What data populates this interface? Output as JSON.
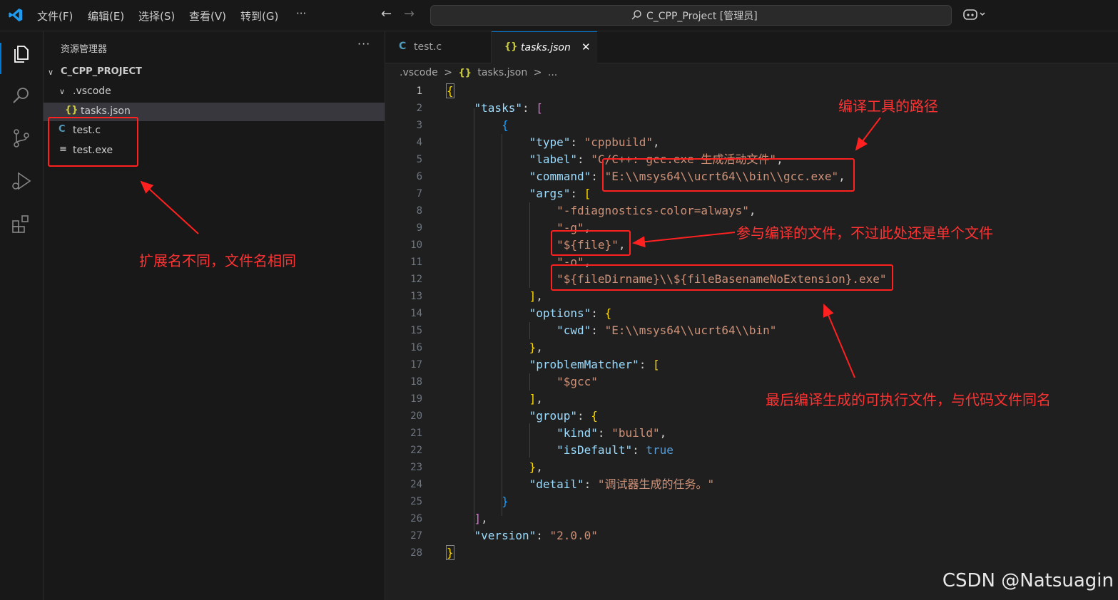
{
  "menu": [
    "文件(F)",
    "编辑(E)",
    "选择(S)",
    "查看(V)",
    "转到(G)",
    "···"
  ],
  "command_center": "C_CPP_Project [管理员]",
  "sidebar": {
    "title": "资源管理器",
    "more": "···",
    "project": "C_CPP_PROJECT",
    "items": [
      {
        "label": ".vscode",
        "icon": "chevron-down-icon"
      },
      {
        "label": "tasks.json",
        "icon": "{}"
      },
      {
        "label": "test.c",
        "icon": "C"
      },
      {
        "label": "test.exe",
        "icon": "≡"
      }
    ]
  },
  "tabs": [
    {
      "icon": "C",
      "label": "test.c"
    },
    {
      "icon": "{}",
      "label": "tasks.json",
      "close": "✕"
    }
  ],
  "breadcrumb": [
    ".vscode",
    ">",
    "{}",
    "tasks.json",
    ">",
    "..."
  ],
  "line_numbers": [
    "1",
    "2",
    "3",
    "4",
    "5",
    "6",
    "7",
    "8",
    "9",
    "10",
    "11",
    "12",
    "13",
    "14",
    "15",
    "16",
    "17",
    "18",
    "19",
    "20",
    "21",
    "22",
    "23",
    "24",
    "25",
    "26",
    "27",
    "28"
  ],
  "code": {
    "l1": "{",
    "l2_key": "\"tasks\"",
    "l2_p": ": ",
    "l2_b": "[",
    "l3": "{",
    "l4_key": "\"type\"",
    "l4_val": "\"cppbuild\"",
    "l5_key": "\"label\"",
    "l5_val": "\"C/C++: gcc.exe 生成活动文件\"",
    "l6_key": "\"command\"",
    "l6_val": "\"E:\\\\msys64\\\\ucrt64\\\\bin\\\\gcc.exe\"",
    "l7_key": "\"args\"",
    "l7_b": "[",
    "l8_val": "\"-fdiagnostics-color=always\"",
    "l9_val": "\"-g\"",
    "l10_val": "\"${file}\"",
    "l11_val": "\"-o\"",
    "l12_val": "\"${fileDirname}\\\\${fileBasenameNoExtension}.exe\"",
    "l13_b": "]",
    "l14_key": "\"options\"",
    "l14_b": "{",
    "l15_key": "\"cwd\"",
    "l15_val": "\"E:\\\\msys64\\\\ucrt64\\\\bin\"",
    "l16_b": "}",
    "l17_key": "\"problemMatcher\"",
    "l17_b": "[",
    "l18_val": "\"$gcc\"",
    "l19_b": "]",
    "l20_key": "\"group\"",
    "l20_b": "{",
    "l21_key": "\"kind\"",
    "l21_val": "\"build\"",
    "l22_key": "\"isDefault\"",
    "l22_val": "true",
    "l23_b": "}",
    "l24_key": "\"detail\"",
    "l24_val": "\"调试器生成的任务。\"",
    "l25_b": "}",
    "l26_b": "]",
    "l27_key": "\"version\"",
    "l27_val": "\"2.0.0\"",
    "l28": "}"
  },
  "annotations": {
    "compiler_path": "编译工具的路径",
    "input_file": "参与编译的文件，不过此处还是单个文件",
    "output_file": "最后编译生成的可执行文件，与代码文件同名",
    "same_name": "扩展名不同，文件名相同"
  },
  "watermark": "CSDN @Natsuagin",
  "colors": {
    "accent": "#0078d4",
    "annotation": "#ff2020",
    "string": "#ce9178",
    "key": "#9cdcfe"
  }
}
